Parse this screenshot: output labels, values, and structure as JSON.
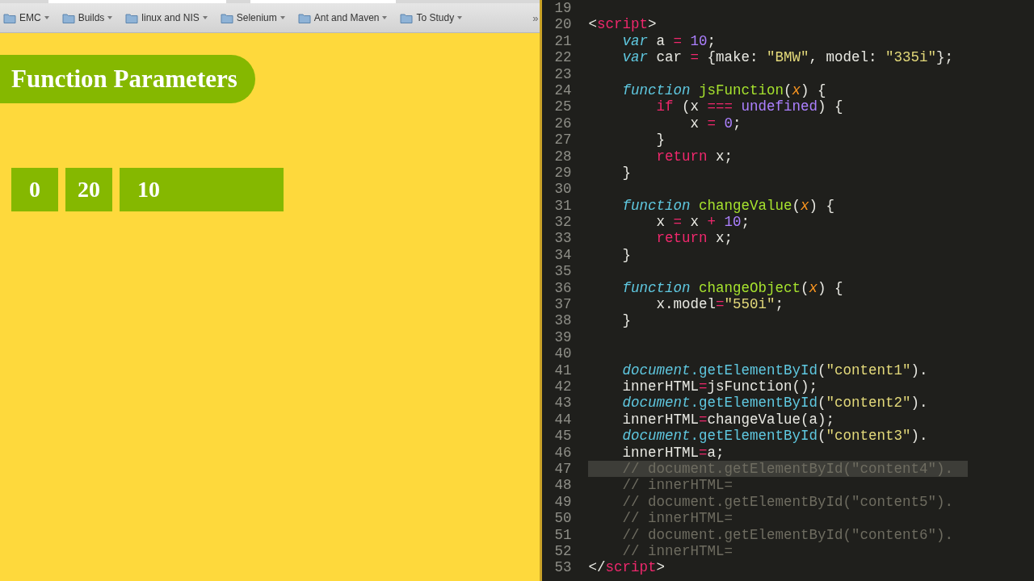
{
  "bookmarks": [
    "EMC",
    "Builds",
    "linux and NIS",
    "Selenium",
    "Ant and Maven",
    "To Study"
  ],
  "bookmarks_more": "»",
  "page": {
    "heading": "Function Parameters",
    "outputs": [
      {
        "text": "0",
        "kind": "small"
      },
      {
        "text": "20",
        "kind": "small"
      },
      {
        "text": "10",
        "kind": "wide"
      }
    ]
  },
  "editor": {
    "lines": [
      {
        "number": "19",
        "selected": false
      },
      {
        "number": "20",
        "selected": false,
        "tokens": [
          {
            "kind": "plain",
            "text": "<"
          },
          {
            "kind": "tag",
            "text": "script"
          },
          {
            "kind": "plain",
            "text": ">"
          }
        ]
      },
      {
        "number": "21",
        "selected": false,
        "tokens": [
          {
            "kind": "storage",
            "text": "    var"
          },
          {
            "kind": "plain",
            "text": " a "
          },
          {
            "kind": "op",
            "text": "="
          },
          {
            "kind": "number",
            "text": " 10"
          },
          {
            "kind": "plain",
            "text": ";"
          }
        ]
      },
      {
        "number": "22",
        "selected": false,
        "tokens": [
          {
            "kind": "storage",
            "text": "    var"
          },
          {
            "kind": "plain",
            "text": " car "
          },
          {
            "kind": "op",
            "text": "="
          },
          {
            "kind": "plain",
            "text": " {make: "
          },
          {
            "kind": "string",
            "text": "\"BMW\""
          },
          {
            "kind": "plain",
            "text": ", model: "
          },
          {
            "kind": "string",
            "text": "\"335i\""
          },
          {
            "kind": "plain",
            "text": "};"
          }
        ]
      },
      {
        "number": "23",
        "selected": false
      },
      {
        "number": "24",
        "selected": false,
        "tokens": [
          {
            "kind": "storage",
            "text": "    function"
          },
          {
            "kind": "func",
            "text": " jsFunction"
          },
          {
            "kind": "plain",
            "text": "("
          },
          {
            "kind": "param",
            "text": "x"
          },
          {
            "kind": "plain",
            "text": ") {"
          }
        ]
      },
      {
        "number": "25",
        "selected": false,
        "tokens": [
          {
            "kind": "keyword",
            "text": "        if"
          },
          {
            "kind": "plain",
            "text": " (x "
          },
          {
            "kind": "op",
            "text": "==="
          },
          {
            "kind": "number",
            "text": " undefined"
          },
          {
            "kind": "plain",
            "text": ") {"
          }
        ]
      },
      {
        "number": "26",
        "selected": false,
        "tokens": [
          {
            "kind": "plain",
            "text": "            x "
          },
          {
            "kind": "op",
            "text": "="
          },
          {
            "kind": "number",
            "text": " 0"
          },
          {
            "kind": "plain",
            "text": ";"
          }
        ]
      },
      {
        "number": "27",
        "selected": false,
        "tokens": [
          {
            "kind": "plain",
            "text": "        }"
          }
        ]
      },
      {
        "number": "28",
        "selected": false,
        "tokens": [
          {
            "kind": "keyword",
            "text": "        return"
          },
          {
            "kind": "plain",
            "text": " x;"
          }
        ]
      },
      {
        "number": "29",
        "selected": false,
        "tokens": [
          {
            "kind": "plain",
            "text": "    }"
          }
        ]
      },
      {
        "number": "30",
        "selected": false
      },
      {
        "number": "31",
        "selected": false,
        "tokens": [
          {
            "kind": "storage",
            "text": "    function"
          },
          {
            "kind": "func",
            "text": " changeValue"
          },
          {
            "kind": "plain",
            "text": "("
          },
          {
            "kind": "param",
            "text": "x"
          },
          {
            "kind": "plain",
            "text": ") {"
          }
        ]
      },
      {
        "number": "32",
        "selected": false,
        "tokens": [
          {
            "kind": "plain",
            "text": "        x "
          },
          {
            "kind": "op",
            "text": "="
          },
          {
            "kind": "plain",
            "text": " x "
          },
          {
            "kind": "op",
            "text": "+"
          },
          {
            "kind": "number",
            "text": " 10"
          },
          {
            "kind": "plain",
            "text": ";"
          }
        ]
      },
      {
        "number": "33",
        "selected": false,
        "tokens": [
          {
            "kind": "keyword",
            "text": "        return"
          },
          {
            "kind": "plain",
            "text": " x;"
          }
        ]
      },
      {
        "number": "34",
        "selected": false,
        "tokens": [
          {
            "kind": "plain",
            "text": "    }"
          }
        ]
      },
      {
        "number": "35",
        "selected": false
      },
      {
        "number": "36",
        "selected": false,
        "tokens": [
          {
            "kind": "storage",
            "text": "    function"
          },
          {
            "kind": "func",
            "text": " changeObject"
          },
          {
            "kind": "plain",
            "text": "("
          },
          {
            "kind": "param",
            "text": "x"
          },
          {
            "kind": "plain",
            "text": ") {"
          }
        ]
      },
      {
        "number": "37",
        "selected": false,
        "tokens": [
          {
            "kind": "plain",
            "text": "        x.model"
          },
          {
            "kind": "op",
            "text": "="
          },
          {
            "kind": "string",
            "text": "\"550i\""
          },
          {
            "kind": "plain",
            "text": ";"
          }
        ]
      },
      {
        "number": "38",
        "selected": false,
        "tokens": [
          {
            "kind": "plain",
            "text": "    }"
          }
        ]
      },
      {
        "number": "39",
        "selected": false
      },
      {
        "number": "40",
        "selected": false
      },
      {
        "number": "41",
        "selected": false,
        "tokens": [
          {
            "kind": "storage",
            "text": "    document"
          },
          {
            "kind": "builtin",
            "text": ".getElementById"
          },
          {
            "kind": "plain",
            "text": "("
          },
          {
            "kind": "string",
            "text": "\"content1\""
          },
          {
            "kind": "plain",
            "text": ")."
          }
        ]
      },
      {
        "number": "42",
        "selected": false,
        "tokens": [
          {
            "kind": "plain",
            "text": "    innerHTML"
          },
          {
            "kind": "op",
            "text": "="
          },
          {
            "kind": "plain",
            "text": "jsFunction();"
          }
        ]
      },
      {
        "number": "43",
        "selected": false,
        "tokens": [
          {
            "kind": "storage",
            "text": "    document"
          },
          {
            "kind": "builtin",
            "text": ".getElementById"
          },
          {
            "kind": "plain",
            "text": "("
          },
          {
            "kind": "string",
            "text": "\"content2\""
          },
          {
            "kind": "plain",
            "text": ")."
          }
        ]
      },
      {
        "number": "44",
        "selected": false,
        "tokens": [
          {
            "kind": "plain",
            "text": "    innerHTML"
          },
          {
            "kind": "op",
            "text": "="
          },
          {
            "kind": "plain",
            "text": "changeValue(a);"
          }
        ]
      },
      {
        "number": "45",
        "selected": false,
        "tokens": [
          {
            "kind": "storage",
            "text": "    document"
          },
          {
            "kind": "builtin",
            "text": ".getElementById"
          },
          {
            "kind": "plain",
            "text": "("
          },
          {
            "kind": "string",
            "text": "\"content3\""
          },
          {
            "kind": "plain",
            "text": ")."
          }
        ]
      },
      {
        "number": "46",
        "selected": false,
        "tokens": [
          {
            "kind": "plain",
            "text": "    innerHTML"
          },
          {
            "kind": "op",
            "text": "="
          },
          {
            "kind": "plain",
            "text": "a;"
          }
        ]
      },
      {
        "number": "47",
        "selected": true,
        "tokens": [
          {
            "kind": "comment",
            "text": "    // document.getElementById(\"content4\")."
          }
        ]
      },
      {
        "number": "48",
        "selected": false,
        "tokens": [
          {
            "kind": "comment",
            "text": "    // innerHTML="
          }
        ]
      },
      {
        "number": "49",
        "selected": false,
        "tokens": [
          {
            "kind": "comment",
            "text": "    // document.getElementById(\"content5\")."
          }
        ]
      },
      {
        "number": "50",
        "selected": false,
        "tokens": [
          {
            "kind": "comment",
            "text": "    // innerHTML="
          }
        ]
      },
      {
        "number": "51",
        "selected": false,
        "tokens": [
          {
            "kind": "comment",
            "text": "    // document.getElementById(\"content6\")."
          }
        ]
      },
      {
        "number": "52",
        "selected": false,
        "tokens": [
          {
            "kind": "comment",
            "text": "    // innerHTML="
          }
        ]
      },
      {
        "number": "53",
        "selected": false,
        "tokens": [
          {
            "kind": "plain",
            "text": "</"
          },
          {
            "kind": "tag",
            "text": "script"
          },
          {
            "kind": "plain",
            "text": ">"
          }
        ]
      }
    ]
  }
}
